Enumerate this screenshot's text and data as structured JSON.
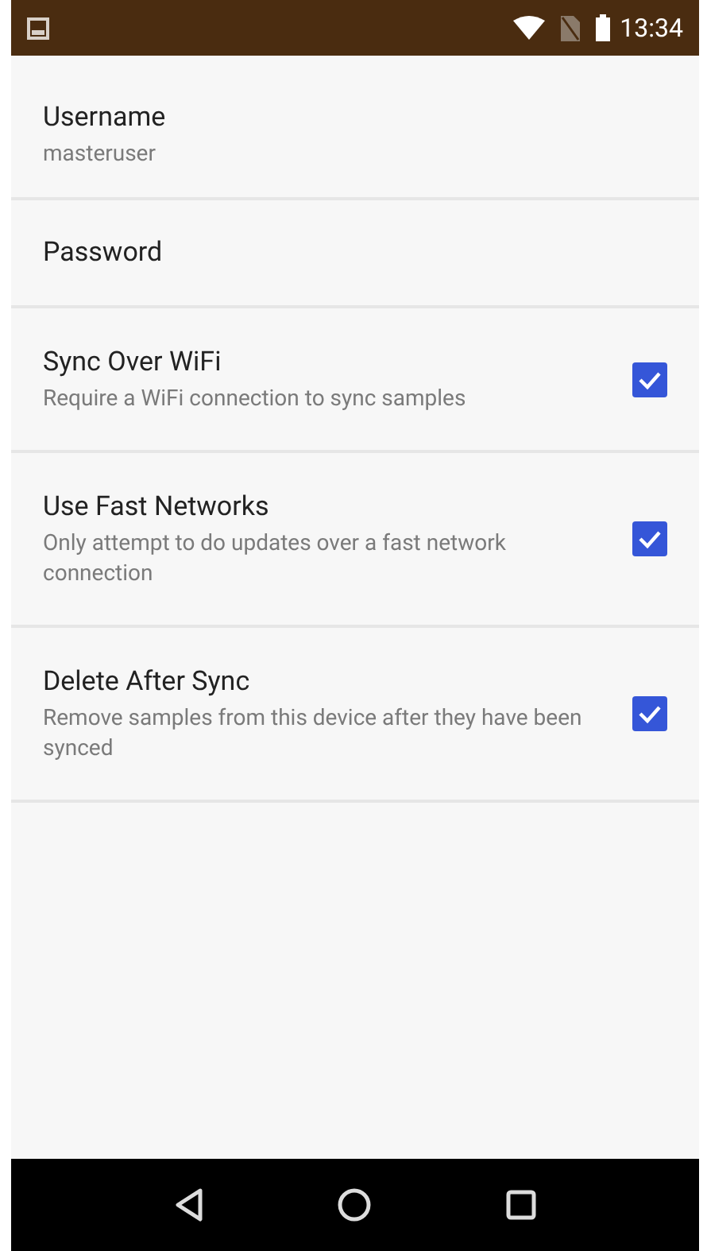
{
  "status_bar": {
    "time": "13:34"
  },
  "preferences": [
    {
      "kind": "text",
      "title": "Username",
      "summary": "masteruser"
    },
    {
      "kind": "text",
      "title": "Password"
    },
    {
      "kind": "checkbox",
      "title": "Sync Over WiFi",
      "summary": "Require a WiFi connection to sync samples",
      "checked": true
    },
    {
      "kind": "checkbox",
      "title": "Use Fast Networks",
      "summary": "Only attempt to do updates over a fast network connection",
      "checked": true
    },
    {
      "kind": "checkbox",
      "title": "Delete After Sync",
      "summary": "Remove samples from this device after they have been synced",
      "checked": true
    }
  ]
}
